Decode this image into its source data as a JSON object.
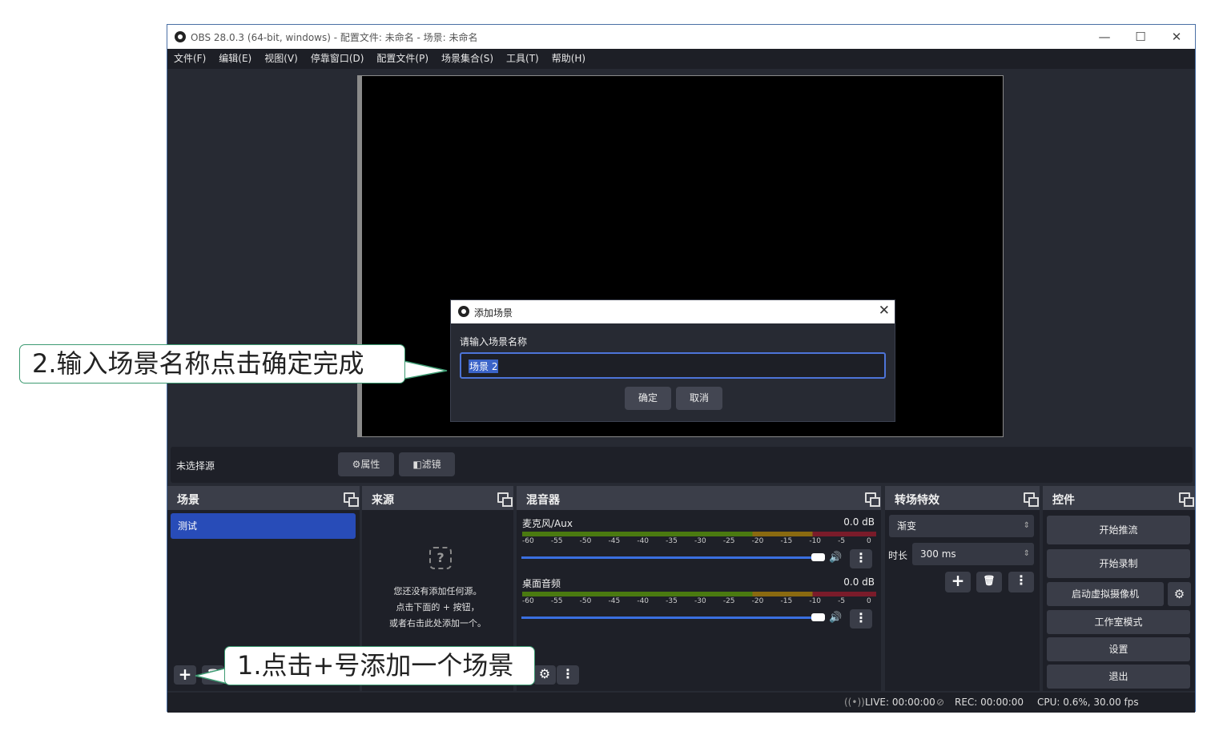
{
  "window": {
    "title": "OBS 28.0.3 (64-bit, windows) - 配置文件: 未命名 - 场景: 未命名",
    "minimize": "—",
    "maximize": "☐",
    "close": "✕"
  },
  "menu": [
    "文件(F)",
    "编辑(E)",
    "视图(V)",
    "停靠窗口(D)",
    "配置文件(P)",
    "场景集合(S)",
    "工具(T)",
    "帮助(H)"
  ],
  "source_bar": {
    "no_source": "未选择源",
    "properties": "属性",
    "filters": "滤镜"
  },
  "docks": {
    "scenes": {
      "title": "场景",
      "items": [
        "测试"
      ]
    },
    "sources": {
      "title": "来源",
      "empty_line1": "您还没有添加任何源。",
      "empty_line2": "点击下面的 + 按钮，",
      "empty_line3": "或者右击此处添加一个。"
    },
    "mixer": {
      "title": "混音器",
      "ticks": [
        "-60",
        "-55",
        "-50",
        "-45",
        "-40",
        "-35",
        "-30",
        "-25",
        "-20",
        "-15",
        "-10",
        "-5",
        "0"
      ],
      "channels": [
        {
          "name": "麦克风/Aux",
          "db": "0.0 dB",
          "volume": 1.0
        },
        {
          "name": "桌面音频",
          "db": "0.0 dB",
          "volume": 1.0
        }
      ]
    },
    "transitions": {
      "title": "转场特效",
      "type": "渐变",
      "duration_label": "时长",
      "duration_value": "300 ms"
    },
    "controls": {
      "title": "控件",
      "start_stream": "开始推流",
      "start_record": "开始录制",
      "virtual_cam": "启动虚拟摄像机",
      "studio_mode": "工作室模式",
      "settings": "设置",
      "exit": "退出"
    }
  },
  "status": {
    "live": "LIVE: 00:00:00",
    "rec": "REC: 00:00:00",
    "cpu": "CPU: 0.6%, 30.00 fps"
  },
  "dialog": {
    "title": "添加场景",
    "prompt": "请输入场景名称",
    "value": "场景 2",
    "ok": "确定",
    "cancel": "取消"
  },
  "callouts": {
    "step1": "1.点击+号添加一个场景",
    "step2": "2.输入场景名称点击确定完成"
  },
  "colors": {
    "selection": "#284cb8",
    "callout_border": "#3d9b72",
    "slider": "#3a6fe0"
  }
}
